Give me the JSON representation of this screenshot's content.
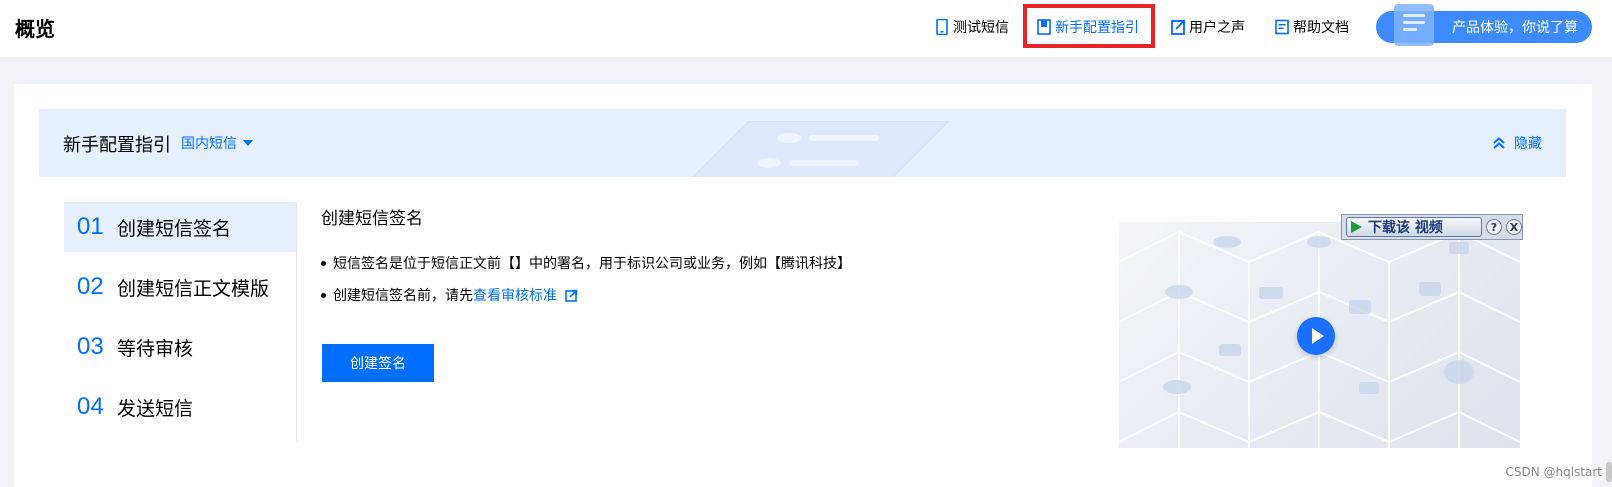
{
  "header": {
    "title": "概览",
    "links": [
      {
        "label": "测试短信",
        "icon": "phone-icon"
      },
      {
        "label": "新手配置指引",
        "icon": "book-icon",
        "active": true
      },
      {
        "label": "用户之声",
        "icon": "external-link-icon"
      },
      {
        "label": "帮助文档",
        "icon": "document-icon"
      }
    ],
    "feedback_label": "产品体验，你说了算"
  },
  "guide": {
    "title": "新手配置指引",
    "region": "国内短信",
    "hide_label": "隐藏",
    "steps": [
      {
        "num": "01",
        "label": "创建短信签名",
        "active": true
      },
      {
        "num": "02",
        "label": "创建短信正文模版"
      },
      {
        "num": "03",
        "label": "等待审核"
      },
      {
        "num": "04",
        "label": "发送短信"
      }
    ],
    "content": {
      "title": "创建短信签名",
      "bullet1": "短信签名是位于短信正文前【】中的署名，用于标识公司或业务，例如【腾讯科技】",
      "bullet2_prefix": "创建短信签名前，请先",
      "bullet2_link": "查看审核标准",
      "button_label": "创建签名"
    },
    "video": {
      "download_label": "下载该 视频",
      "help_label": "?",
      "close_label": "X"
    }
  },
  "watermark": "CSDN @hqlstart",
  "colors": {
    "accent": "#006eff",
    "highlight": "#e8242b",
    "guide_bg": "#e6f0fd"
  }
}
